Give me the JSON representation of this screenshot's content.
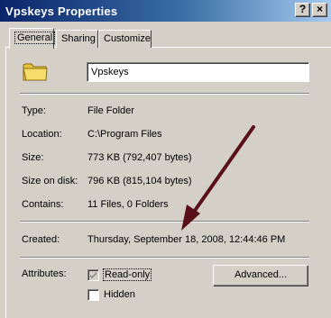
{
  "window": {
    "title": "Vpskeys Properties",
    "help_label": "?",
    "close_label": "×"
  },
  "tabs": [
    {
      "label": "General",
      "active": true
    },
    {
      "label": "Sharing",
      "active": false
    },
    {
      "label": "Customize",
      "active": false
    }
  ],
  "general": {
    "name": "Vpskeys",
    "folder_icon": "folder-icon",
    "type_label": "Type:",
    "type_value": "File Folder",
    "location_label": "Location:",
    "location_value": "C:\\Program Files",
    "size_label": "Size:",
    "size_value": "773 KB (792,407 bytes)",
    "size_on_disk_label": "Size on disk:",
    "size_on_disk_value": "796 KB (815,104 bytes)",
    "contains_label": "Contains:",
    "contains_value": "11 Files, 0 Folders",
    "created_label": "Created:",
    "created_value": "Thursday, September 18, 2008, 12:44:46 PM",
    "attributes_label": "Attributes:",
    "readonly_label": "Read-only",
    "readonly_checked": true,
    "hidden_label": "Hidden",
    "hidden_checked": false,
    "advanced_label": "Advanced..."
  },
  "colors": {
    "titlebar_start": "#0a246a",
    "titlebar_end": "#a6caf0",
    "face": "#d4d0c8",
    "annotation_arrow": "#5a1018"
  }
}
